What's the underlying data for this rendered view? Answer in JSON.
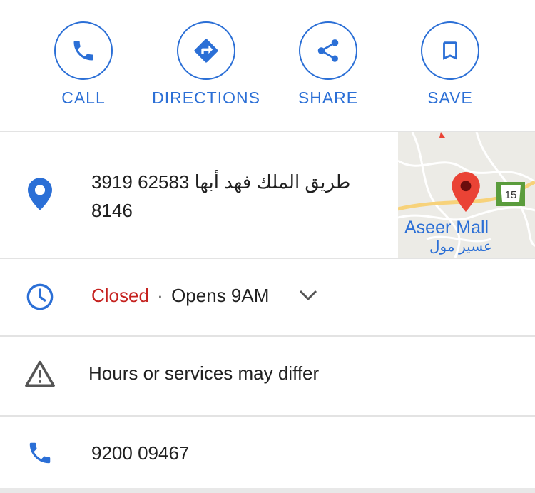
{
  "actions": {
    "call": {
      "label": "CALL",
      "icon": "phone-icon"
    },
    "directions": {
      "label": "DIRECTIONS",
      "icon": "directions-icon"
    },
    "share": {
      "label": "SHARE",
      "icon": "share-icon"
    },
    "save": {
      "label": "SAVE",
      "icon": "bookmark-icon"
    }
  },
  "address": {
    "line1": "3919 طريق الملك فهد أبها 62583",
    "line2": "8146",
    "icon": "location-pin-icon"
  },
  "map": {
    "place_name": "Aseer Mall",
    "place_name_arabic": "عسير مول",
    "road_shield": "15"
  },
  "hours": {
    "status": "Closed",
    "separator": "·",
    "opens": "Opens 9AM",
    "icon": "clock-icon"
  },
  "notice": {
    "text": "Hours or services may differ",
    "icon": "warning-icon"
  },
  "phone": {
    "number": "9200 09467",
    "icon": "phone-icon"
  },
  "colors": {
    "accent": "#2b6fd6",
    "closed": "#c5221f",
    "divider": "#e3e3e3",
    "pin": "#ea4335"
  }
}
